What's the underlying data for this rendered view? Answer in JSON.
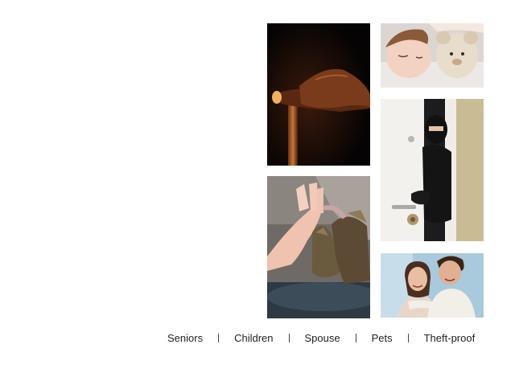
{
  "photos": [
    {
      "subject": "cane-photo"
    },
    {
      "subject": "sleeping-child-photo"
    },
    {
      "subject": "masked-burglar-photo"
    },
    {
      "subject": "hand-and-cat-paw-photo"
    },
    {
      "subject": "couple-photo"
    }
  ],
  "captions": {
    "seniors": "Seniors",
    "children": "Children",
    "spouse": "Spouse",
    "pets": "Pets",
    "theft_proof": "Theft-proof"
  },
  "colors": {
    "background": "#ffffff",
    "caption_text": "#222222",
    "separator": "#444444"
  }
}
